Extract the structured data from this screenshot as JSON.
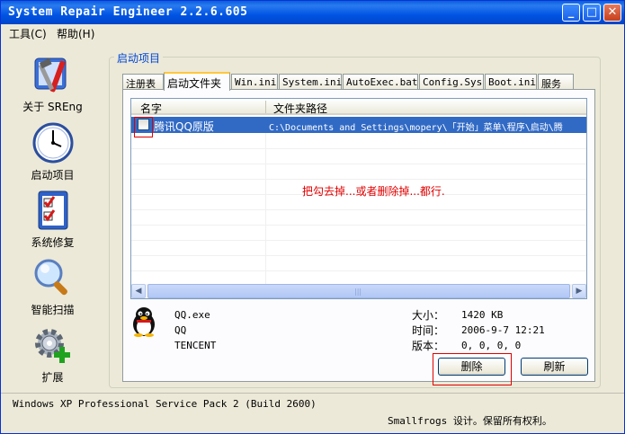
{
  "window": {
    "title": "System Repair Engineer 2.2.6.605"
  },
  "menu": {
    "tools": "工具(C)",
    "help": "帮助(H)"
  },
  "sidebar": {
    "items": [
      {
        "label": "关于 SREng",
        "icon": "tools-icon"
      },
      {
        "label": "启动项目",
        "icon": "clock-icon"
      },
      {
        "label": "系统修复",
        "icon": "checklist-icon"
      },
      {
        "label": "智能扫描",
        "icon": "magnifier-icon"
      },
      {
        "label": "扩展",
        "icon": "gear-plus-icon"
      }
    ]
  },
  "group": {
    "title": "启动项目"
  },
  "tabs": [
    "注册表",
    "启动文件夹",
    "Win.ini",
    "System.ini",
    "AutoExec.bat",
    "Config.Sys",
    "Boot.ini",
    "服务"
  ],
  "active_tab": "启动文件夹",
  "list": {
    "columns": [
      "名字",
      "文件夹路径"
    ],
    "rows": [
      {
        "name": "腾讯QQ原版",
        "path": "C:\\Documents and Settings\\mopery\\「开始」菜单\\程序\\启动\\腾",
        "checked": false
      }
    ]
  },
  "annotation": {
    "hint": "把勾去掉...或者删除掉...都行."
  },
  "details": {
    "icon": "penguin-icon",
    "file": "QQ.exe",
    "product": "QQ",
    "company": "TENCENT",
    "size_label": "大小：",
    "size_value": "1420 KB",
    "time_label": "时间：",
    "time_value": "2006-9-7 12:21",
    "version_label": "版本：",
    "version_value": "0, 0, 0, 0"
  },
  "buttons": {
    "delete": "删除",
    "refresh": "刷新"
  },
  "status": {
    "os": "Windows XP Professional Service Pack 2 (Build 2600)",
    "copyright": "Smallfrogs 设计。保留所有权利。"
  },
  "colors": {
    "titlebar": "#0054e3",
    "selection": "#316ac5",
    "annotation": "#e00000",
    "group_title": "#0046d5"
  }
}
